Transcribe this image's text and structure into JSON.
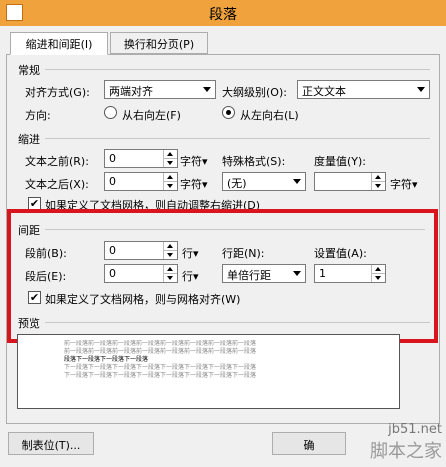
{
  "window": {
    "title": "段落"
  },
  "tabs": [
    "缩进和间距(I)",
    "换行和分页(P)"
  ],
  "general": {
    "heading": "常规",
    "align_label": "对齐方式(G):",
    "align_value": "两端对齐",
    "outline_label": "大纲级别(O):",
    "outline_value": "正文文本",
    "direction_label": "方向:",
    "rtl_label": "从右向左(F)",
    "ltr_label": "从左向右(L)"
  },
  "indent": {
    "heading": "缩进",
    "before_label": "文本之前(R):",
    "before_value": "0",
    "before_unit": "字符▾",
    "after_label": "文本之后(X):",
    "after_value": "0",
    "after_unit": "字符▾",
    "special_label": "特殊格式(S):",
    "special_value": "(无)",
    "measure_label": "度量值(Y):",
    "measure_value": "",
    "measure_unit": "字符▾",
    "auto_adjust_label": "如果定义了文档网格，则自动调整右缩进(D)"
  },
  "spacing": {
    "heading": "间距",
    "before_label": "段前(B):",
    "before_value": "0",
    "before_unit": "行▾",
    "after_label": "段后(E):",
    "after_value": "0",
    "after_unit": "行▾",
    "line_label": "行距(N):",
    "line_value": "单倍行距",
    "setting_label": "设置值(A):",
    "setting_value": "1",
    "snap_label": "如果定义了文档网格，则与网格对齐(W)"
  },
  "preview": {
    "heading": "预览",
    "lines": [
      "前一段落前一段落前一段落前一段落前一段落前一段落前一段落前一段落",
      "前一段落前一段落前一段落前一段落前一段落前一段落前一段落前一段落",
      "段落下一段落下一段落下一段落",
      "下一段落下一段落下一段落下一段落下一段落下一段落下一段落下一段落",
      "下一段落下一段落下一段落下一段落下一段落下一段落下一段落下一段落"
    ]
  },
  "buttons": {
    "tabs_label": "制表位(T)...",
    "ok_label": "确"
  },
  "watermark": {
    "site": "jb51.net",
    "text": "脚本之家"
  }
}
